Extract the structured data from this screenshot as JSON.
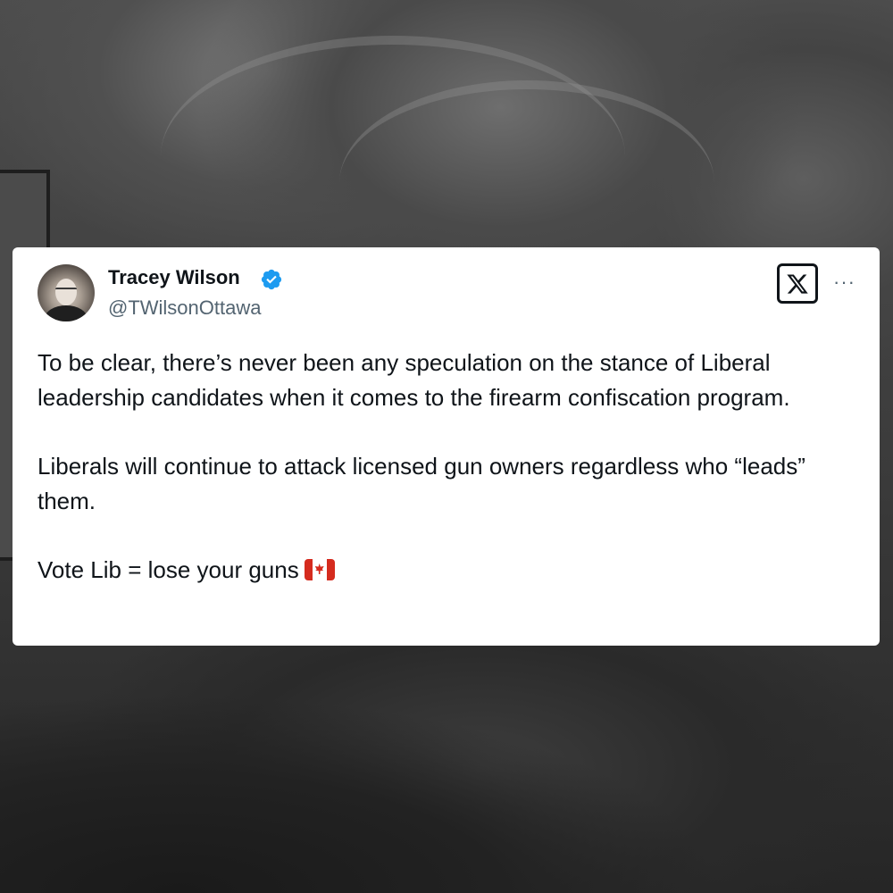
{
  "tweet": {
    "author": {
      "display_name": "Tracey Wilson",
      "handle": "@TWilsonOttawa",
      "verified": true
    },
    "paragraphs": [
      "To be clear, there’s never been any speculation on the stance of Liberal leadership candidates when it comes to the firearm confiscation program.",
      "Liberals will continue to attack licensed gun owners regardless who “leads” them.",
      "Vote Lib = lose your guns"
    ],
    "trailing_emoji": "canada-flag-icon",
    "more_label": "···"
  },
  "colors": {
    "card_bg": "#ffffff",
    "text_primary": "#0f1419",
    "text_secondary": "#536471",
    "verified_blue": "#1d9bf0",
    "flag_red": "#d52b1e"
  },
  "icons": {
    "verified": "verified-badge-icon",
    "brand": "x-logo-icon",
    "more": "more-horizontal-icon"
  }
}
